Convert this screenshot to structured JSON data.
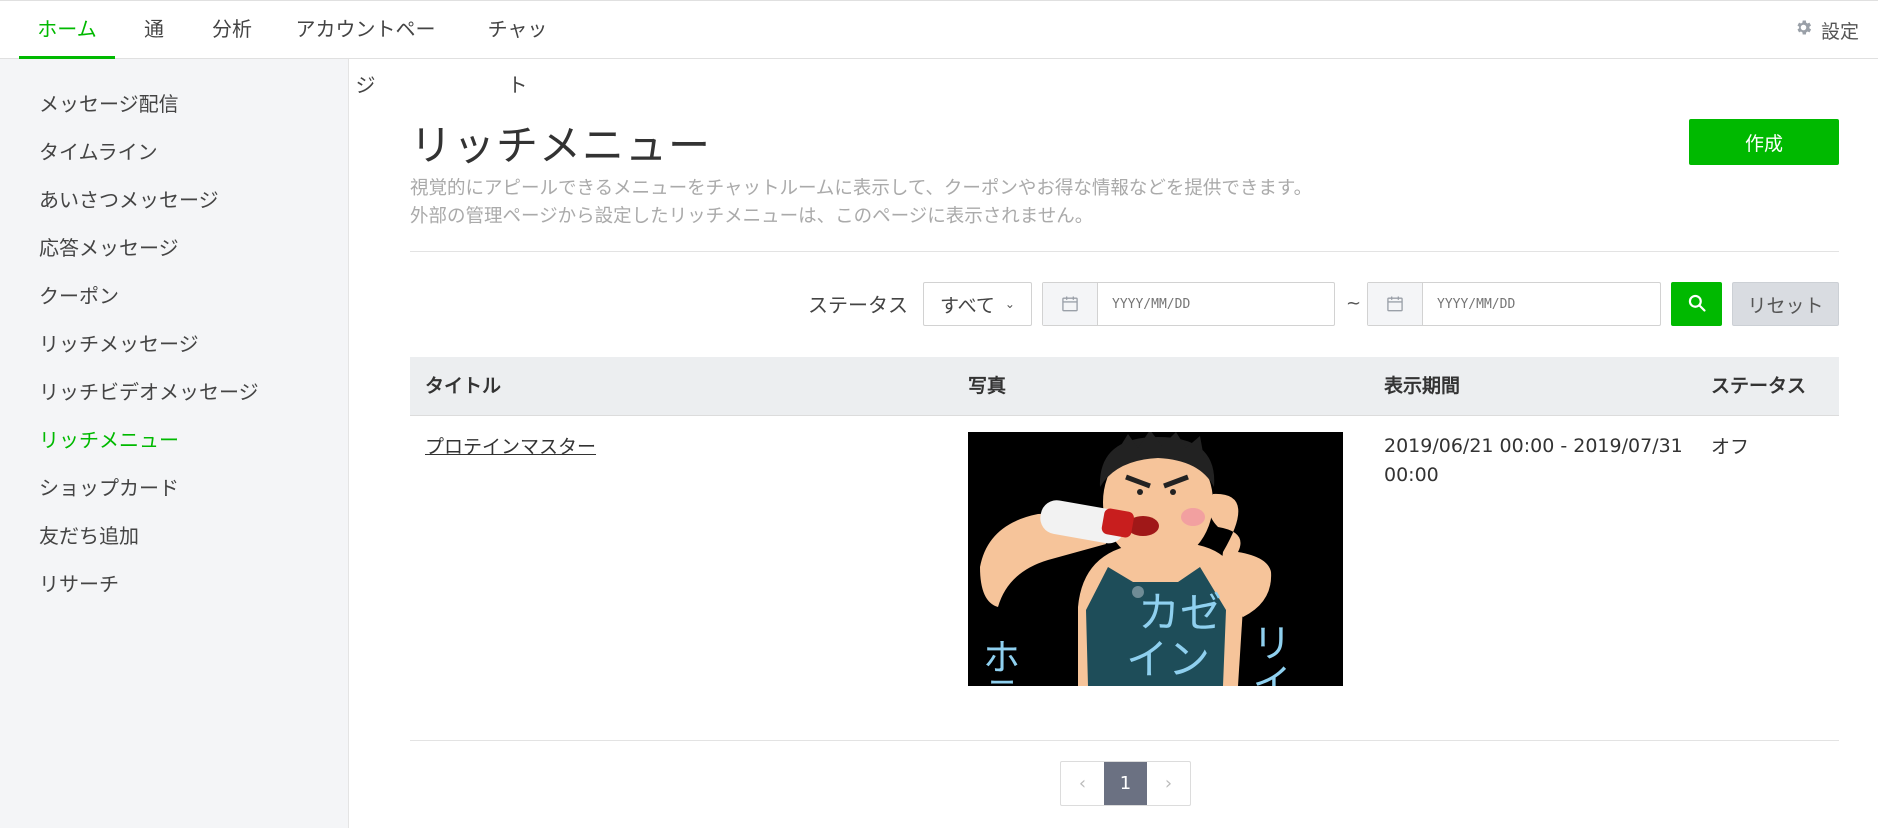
{
  "topnav": {
    "tabs": [
      {
        "label": "ホーム",
        "active": true
      },
      {
        "label": "通知",
        "active": false
      },
      {
        "label": "分析",
        "active": false
      },
      {
        "label": "アカウントページ",
        "active": false
      },
      {
        "label": "チャット",
        "active": false
      }
    ],
    "settings_label": "設定",
    "settings_icon": "gear-icon"
  },
  "sidebar": {
    "items": [
      {
        "label": "メッセージ配信",
        "active": false
      },
      {
        "label": "タイムライン",
        "active": false
      },
      {
        "label": "あいさつメッセージ",
        "active": false
      },
      {
        "label": "応答メッセージ",
        "active": false
      },
      {
        "label": "クーポン",
        "active": false
      },
      {
        "label": "リッチメッセージ",
        "active": false
      },
      {
        "label": "リッチビデオメッセージ",
        "active": false
      },
      {
        "label": "リッチメニュー",
        "active": true
      },
      {
        "label": "ショップカード",
        "active": false
      },
      {
        "label": "友だち追加",
        "active": false
      },
      {
        "label": "リサーチ",
        "active": false
      }
    ]
  },
  "page": {
    "title": "リッチメニュー",
    "description_line1": "視覚的にアピールできるメニューをチャットルームに表示して、クーポンやお得な情報などを提供できます。",
    "description_line2": "外部の管理ページから設定したリッチメニューは、このページに表示されません。",
    "create_label": "作成"
  },
  "filter": {
    "status_label": "ステータス",
    "status_value": "すべて",
    "date_from_placeholder": "YYYY/MM/DD",
    "date_to_placeholder": "YYYY/MM/DD",
    "separator": "~",
    "reset_label": "リセット"
  },
  "table": {
    "headers": {
      "title": "タイトル",
      "photo": "写真",
      "period": "表示期間",
      "status": "ステータス"
    },
    "rows": [
      {
        "title": "プロテインマスター",
        "period_line1": "2019/06/21 00:00 - 2019/07/31",
        "period_line2": "00:00",
        "status": "オフ",
        "photo_text": {
          "left": "ホテ",
          "center_top": "カゼ",
          "center_bottom": "イン",
          "right": "リイ"
        }
      }
    ]
  },
  "pagination": {
    "prev": "‹",
    "current": "1",
    "next": "›"
  },
  "colors": {
    "accent": "#00b900",
    "sidebar_bg": "#f4f5f7",
    "table_header_bg": "#eceef0",
    "pager_current": "#6b7182"
  }
}
